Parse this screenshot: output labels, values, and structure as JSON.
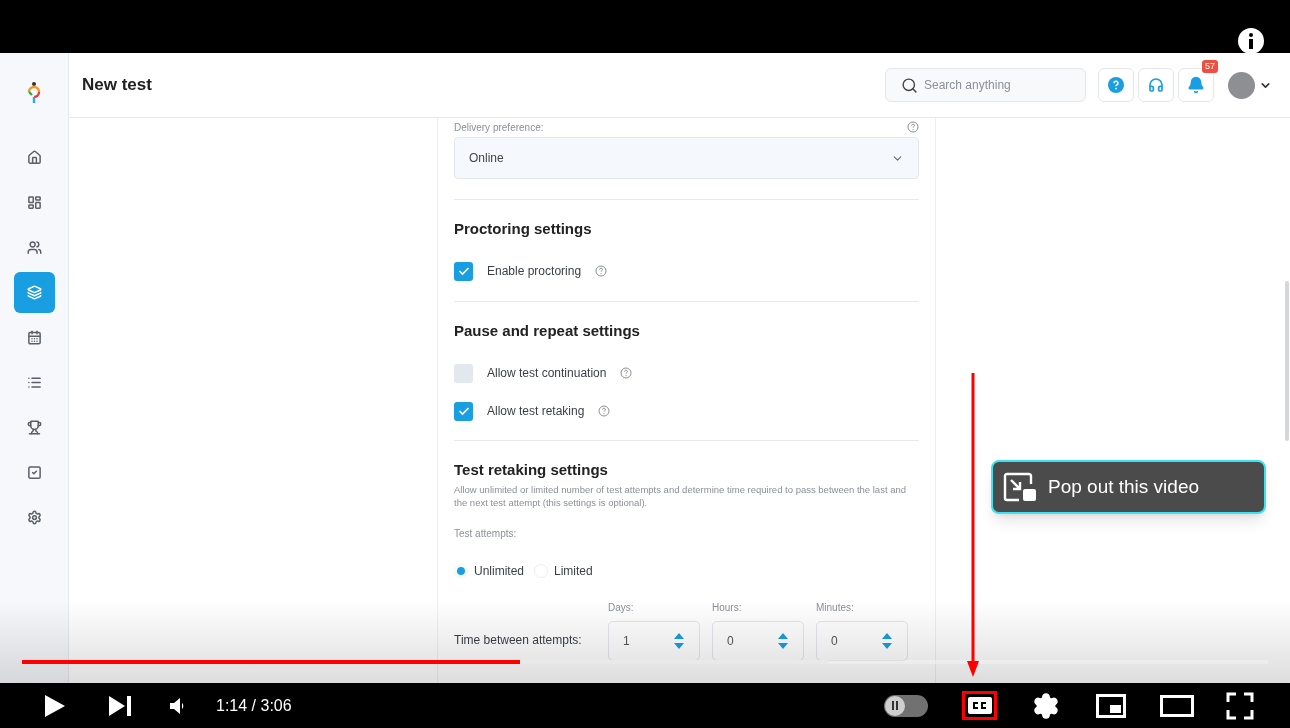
{
  "app": {
    "title": "New test",
    "search": {
      "placeholder": "Search anything"
    },
    "notification_count": "57",
    "sidebar": {
      "items": [
        {
          "selected": false
        },
        {
          "selected": false
        },
        {
          "selected": false
        },
        {
          "selected": true
        },
        {
          "selected": false
        },
        {
          "selected": false
        },
        {
          "selected": false
        },
        {
          "selected": false
        },
        {
          "selected": false
        }
      ]
    },
    "form": {
      "delivery": {
        "label": "Delivery preference:",
        "value": "Online"
      },
      "sections": [
        {
          "title": "Proctoring settings",
          "checkboxes": [
            {
              "label": "Enable proctoring",
              "checked": true
            }
          ]
        },
        {
          "title": "Pause and repeat settings",
          "checkboxes": [
            {
              "label": "Allow test continuation",
              "checked": false
            },
            {
              "label": "Allow test retaking",
              "checked": true
            }
          ]
        }
      ],
      "retaking": {
        "title": "Test retaking settings",
        "description": "Allow unlimited or limited number of test attempts and determine time required to pass between the last and the next test attempt (this settings is optional).",
        "attempts_label": "Test attempts:",
        "options": [
          {
            "label": "Unlimited",
            "selected": true
          },
          {
            "label": "Limited",
            "selected": false
          }
        ],
        "time_label": "Time between attempts:",
        "fields": [
          {
            "label": "Days:",
            "value": "1"
          },
          {
            "label": "Hours:",
            "value": "0"
          },
          {
            "label": "Minutes:",
            "value": "0"
          }
        ]
      }
    }
  },
  "player": {
    "played": {
      "level": 0.4
    },
    "buffered": {
      "level": 0.647
    },
    "time": "1:14 / 3:06",
    "autoplay": {
      "on": false
    },
    "tooltip": "Pop out this video"
  }
}
